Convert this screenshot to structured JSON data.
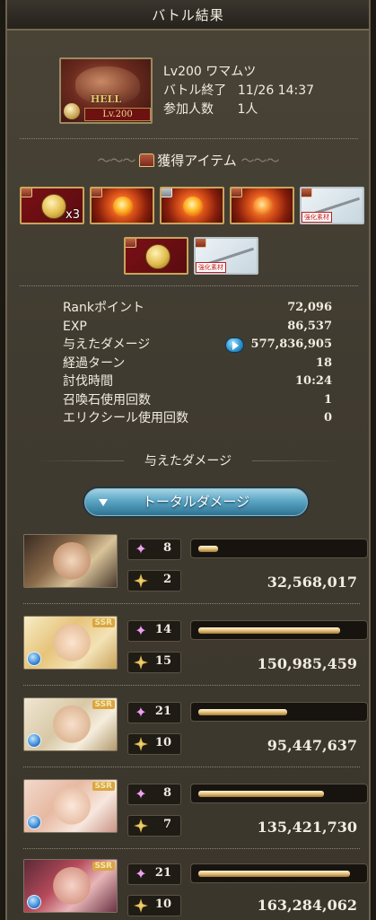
{
  "header": {
    "title": "バトル結果"
  },
  "quest": {
    "thumb_text": "HELL",
    "thumb_level": "Lv.200",
    "title": "Lv200 ワマムツ",
    "end_label": "バトル終了",
    "end_time": "11/26 14:37",
    "participants_label": "参加人数",
    "participants_value": "1人"
  },
  "items_section": {
    "title": "獲得アイテム"
  },
  "items": [
    {
      "kind": "medal",
      "count": "x3"
    },
    {
      "kind": "orb",
      "count": ""
    },
    {
      "kind": "flame-orb",
      "count": ""
    },
    {
      "kind": "flame-medal",
      "count": ""
    },
    {
      "kind": "spear",
      "tag": "強化素材"
    },
    {
      "kind": "medal",
      "count": ""
    },
    {
      "kind": "spear",
      "tag": "強化素材"
    }
  ],
  "stats": [
    {
      "label": "Rankポイント",
      "value": "72,096"
    },
    {
      "label": "EXP",
      "value": "86,537"
    },
    {
      "label": "与えたダメージ",
      "value": "577,836,905"
    },
    {
      "label": "経過ターン",
      "value": "18"
    },
    {
      "label": "討伐時間",
      "value": "10:24"
    },
    {
      "label": "召喚石使用回数",
      "value": "1"
    },
    {
      "label": "エリクシール使用回数",
      "value": "0"
    }
  ],
  "damage_section": {
    "title": "与えたダメージ",
    "button_label": "トータルダメージ"
  },
  "characters": [
    {
      "name": "character-1",
      "skill_count": "8",
      "attack_count": "2",
      "damage": "32,568,017",
      "share": 0.12,
      "ssr": "",
      "element_icon": ""
    },
    {
      "name": "character-2",
      "skill_count": "14",
      "attack_count": "15",
      "damage": "150,985,459",
      "share": 0.88,
      "ssr": "SSR",
      "element_icon": "water-element-icon"
    },
    {
      "name": "character-3",
      "skill_count": "21",
      "attack_count": "10",
      "damage": "95,447,637",
      "share": 0.55,
      "ssr": "SSR",
      "element_icon": "water-element-icon"
    },
    {
      "name": "character-4",
      "skill_count": "8",
      "attack_count": "7",
      "damage": "135,421,730",
      "share": 0.78,
      "ssr": "SSR",
      "element_icon": "water-element-icon"
    },
    {
      "name": "character-5",
      "skill_count": "21",
      "attack_count": "10",
      "damage": "163,284,062",
      "share": 0.94,
      "ssr": "SSR",
      "element_icon": "water-element-icon"
    }
  ]
}
